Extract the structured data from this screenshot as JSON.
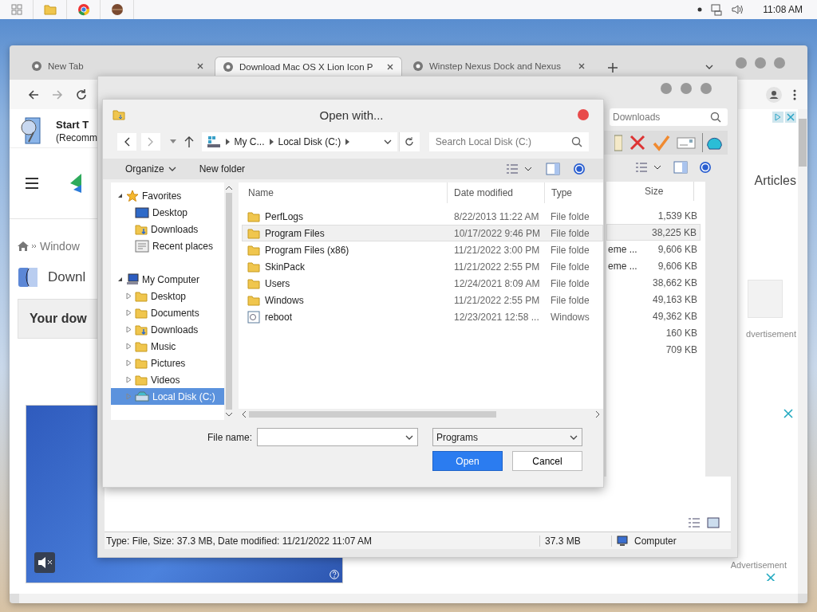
{
  "taskbar": {
    "clock": "11:08 AM"
  },
  "browser": {
    "tabs": [
      {
        "title": "New Tab",
        "selected": false
      },
      {
        "title": "Download Mac OS X Lion Icon P",
        "selected": true
      },
      {
        "title": "Winstep Nexus Dock and Nexus",
        "selected": false
      }
    ],
    "page": {
      "promo_title": "Start T",
      "promo_subtitle": "(Recomm",
      "breadcrumb": "Window",
      "heading": "Downl",
      "notice": "Your dow",
      "nav_link": "Articles",
      "ad_label_top": "dvertisement",
      "ad_label_bottom": "Advertisement"
    }
  },
  "explorer": {
    "search_placeholder": "Downloads",
    "size_column": "Size",
    "rows": [
      {
        "size": "1,539 KB",
        "selected": false
      },
      {
        "size": "38,225 KB",
        "selected": true
      },
      {
        "column_2": "eme ...",
        "size": "9,606 KB",
        "selected": false
      },
      {
        "column_2": "eme ...",
        "size": "9,606 KB",
        "selected": false
      },
      {
        "size": "38,662 KB",
        "selected": false
      },
      {
        "size": "49,163 KB",
        "selected": false
      },
      {
        "size": "49,362 KB",
        "selected": false
      },
      {
        "size": "160 KB",
        "selected": false
      },
      {
        "size": "709 KB",
        "selected": false
      }
    ],
    "status_bar": {
      "text": "Type: File, Size: 37.3 MB, Date modified: 11/21/2022 11:07 AM",
      "size": "37.3 MB",
      "zone": "Computer"
    }
  },
  "dialog": {
    "title": "Open with...",
    "path": [
      "My C...",
      "Local Disk (C:)"
    ],
    "search_placeholder": "Search Local Disk (C:)",
    "toolbar": [
      "Organize",
      "New folder"
    ],
    "nav": [
      {
        "label": "Favorites",
        "kind": "favorites",
        "expanded": true,
        "selected": false,
        "children": [
          {
            "label": "Desktop",
            "kind": "desktop",
            "selected": false
          },
          {
            "label": "Downloads",
            "kind": "downloads",
            "selected": false
          },
          {
            "label": "Recent places",
            "kind": "recent",
            "selected": false
          }
        ]
      },
      {
        "label": "My Computer",
        "kind": "computer",
        "expanded": true,
        "selected": false,
        "children": [
          {
            "label": "Desktop",
            "kind": "folder",
            "expanded": false,
            "selected": false
          },
          {
            "label": "Documents",
            "kind": "folder",
            "expanded": false,
            "selected": false
          },
          {
            "label": "Downloads",
            "kind": "downloads",
            "expanded": false,
            "selected": false
          },
          {
            "label": "Music",
            "kind": "folder",
            "expanded": false,
            "selected": false
          },
          {
            "label": "Pictures",
            "kind": "folder",
            "expanded": false,
            "selected": false
          },
          {
            "label": "Videos",
            "kind": "folder",
            "expanded": false,
            "selected": false
          },
          {
            "label": "Local Disk (C:)",
            "kind": "drive",
            "expanded": false,
            "selected": true
          }
        ]
      }
    ],
    "columns": [
      "Name",
      "Date modified",
      "Type"
    ],
    "rows": [
      {
        "name": "PerfLogs",
        "date": "8/22/2013 11:22 AM",
        "type": "File folde",
        "kind": "folder",
        "selected": false
      },
      {
        "name": "Program Files",
        "date": "10/17/2022 9:46 PM",
        "type": "File folde",
        "kind": "folder",
        "selected": true
      },
      {
        "name": "Program Files (x86)",
        "date": "11/21/2022 3:00 PM",
        "type": "File folde",
        "kind": "folder",
        "selected": false
      },
      {
        "name": "SkinPack",
        "date": "11/21/2022 2:55 PM",
        "type": "File folde",
        "kind": "folder",
        "selected": false
      },
      {
        "name": "Users",
        "date": "12/24/2021 8:09 AM",
        "type": "File folde",
        "kind": "folder",
        "selected": false
      },
      {
        "name": "Windows",
        "date": "11/21/2022 2:55 PM",
        "type": "File folde",
        "kind": "folder",
        "selected": false
      },
      {
        "name": "reboot",
        "date": "12/23/2021 12:58 ...",
        "type": "Windows",
        "kind": "file",
        "selected": false
      }
    ],
    "file_name": {
      "label": "File name:"
    },
    "filter": "Programs",
    "buttons": [
      {
        "label": "Open",
        "kind": "primary"
      },
      {
        "label": "Cancel",
        "kind": "secondary"
      }
    ]
  }
}
